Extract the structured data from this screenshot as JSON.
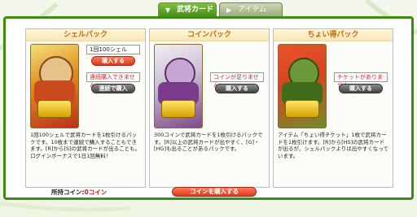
{
  "tabs": [
    {
      "label": "武将カード",
      "icon": "▼"
    },
    {
      "label": "アイテム",
      "icon": "▶"
    }
  ],
  "cards": [
    {
      "title": "シェルパック",
      "price": "1回100シェル",
      "buy_label": "購入する",
      "notice": "連続購入できません",
      "multi_buy_label": "連続で購入",
      "description": "1回100シェルで武将カードを1枚引けるパックです。10枚まで連続で購入することもできます。[R]から[S]の武将カードが出ることも。ログインボーナスで1日1回無料！"
    },
    {
      "title": "コインパック",
      "notice": "コインが足りません",
      "buy_label": "購入する",
      "description": "300コインで武将カードを1枚引けるパックです。[R]以上の武将カードが出やすく、[G]・[HG]も出ることがあるパックです。"
    },
    {
      "title": "ちょい得パック",
      "notice": "チケットがありません",
      "buy_label": "購入する",
      "description": "アイテム「ちょい得チケット」1枚で武将カードを1枚引けます。[R]から[HS]の武将カードが出るが、シェルパックよりは出やすくなっています。"
    }
  ],
  "footer": {
    "coins_label": "所持コイン:",
    "coins_value": "0コイン",
    "buy_coins_label": "コインを購入する"
  }
}
